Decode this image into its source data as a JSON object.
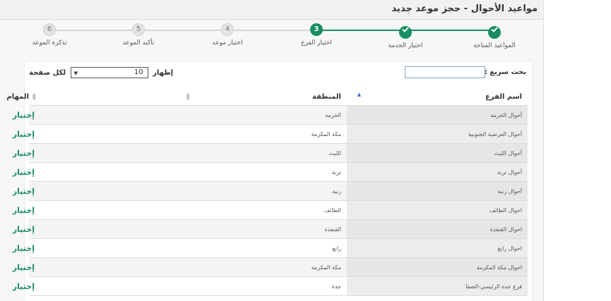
{
  "header": {
    "title": "مواعيد الأحوال - حجز موعد جديد"
  },
  "stepper": {
    "accent": "#1a8e5f",
    "steps": [
      {
        "num": "1",
        "label": "المواعيد المتاحة",
        "state": "done"
      },
      {
        "num": "2",
        "label": "اختيار الخدمة",
        "state": "done"
      },
      {
        "num": "3",
        "label": "اختيار الفرع",
        "state": "current"
      },
      {
        "num": "4",
        "label": "اختيار موعد",
        "state": "pending"
      },
      {
        "num": "5",
        "label": "تأكيد الموعد",
        "state": "pending"
      },
      {
        "num": "6",
        "label": "تذكرة الموعد",
        "state": "pending"
      }
    ]
  },
  "controls": {
    "search_label": "بحث سريع :",
    "search_value": "",
    "show_label": "إظهار",
    "page_length": "10",
    "per_page_label": "لكل صفحة"
  },
  "table": {
    "columns": [
      "اسم الفرع",
      "المنطقة",
      "المهام"
    ],
    "action_label": "إختيار",
    "rows": [
      {
        "branch": "أحوال الخرمة",
        "region": "الخرمة"
      },
      {
        "branch": "أحوال العرضية الجنوبية",
        "region": "مكة المكرمة"
      },
      {
        "branch": "أحوال الليث",
        "region": "الليث"
      },
      {
        "branch": "أحوال تربة",
        "region": "تربة"
      },
      {
        "branch": "أحوال رنية",
        "region": "رنية"
      },
      {
        "branch": "احوال الطائف",
        "region": "الطائف"
      },
      {
        "branch": "احوال القنفذة",
        "region": "القنفذة"
      },
      {
        "branch": "احوال رابغ",
        "region": "رابغ"
      },
      {
        "branch": "احوال مكة المكرمة",
        "region": "مكة المكرمة"
      },
      {
        "branch": "فرع جدة الرئيسي-الصفا",
        "region": "جدة"
      }
    ]
  }
}
